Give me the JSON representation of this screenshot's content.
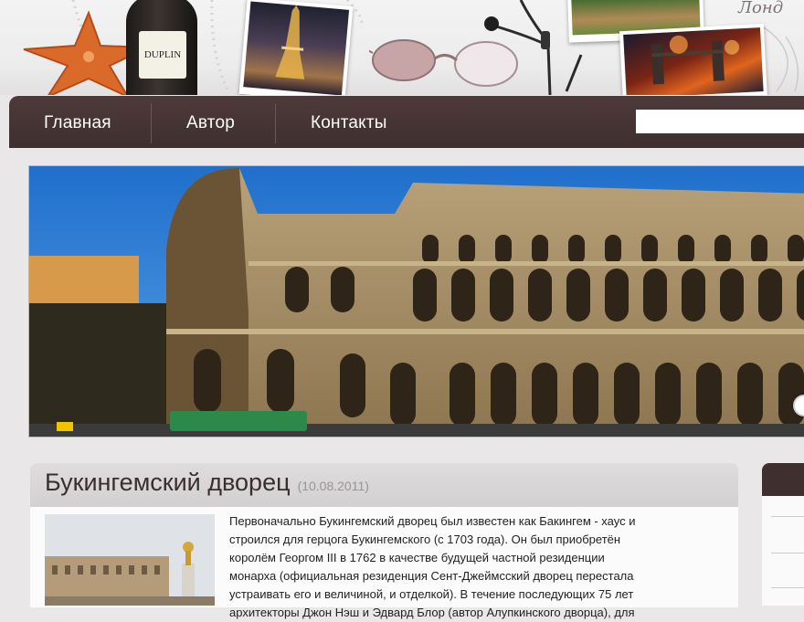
{
  "header": {
    "bottle_label": "DUPLIN",
    "script_text": "Лонд"
  },
  "nav": {
    "items": [
      {
        "label": "Главная"
      },
      {
        "label": "Автор"
      },
      {
        "label": "Контакты"
      }
    ],
    "search": {
      "value": "",
      "placeholder": ""
    }
  },
  "article": {
    "title": "Букингемский дворец",
    "date": "(10.08.2011)",
    "paragraph_lines": [
      "Первоначально Букингемский дворец был известен как Бакингем - хаус и",
      "строился для герцога Букингемского (с 1703 года). Он был приобретён",
      "королём Георгом III в 1762 в качестве будущей частной резиденции",
      "монарха (официальная резиденция Сент-Джеймсский дворец перестала",
      "устраивать его и величиной, и отделкой). В течение последующих 75 лет",
      "архитекторы Джон Нэш и Эдвард Блор (автор Алупкинского дворца), для"
    ]
  },
  "colors": {
    "nav_bg": "#4e3a3a",
    "page_bg": "#e9e7e7",
    "title_color": "#3a2e2e"
  }
}
